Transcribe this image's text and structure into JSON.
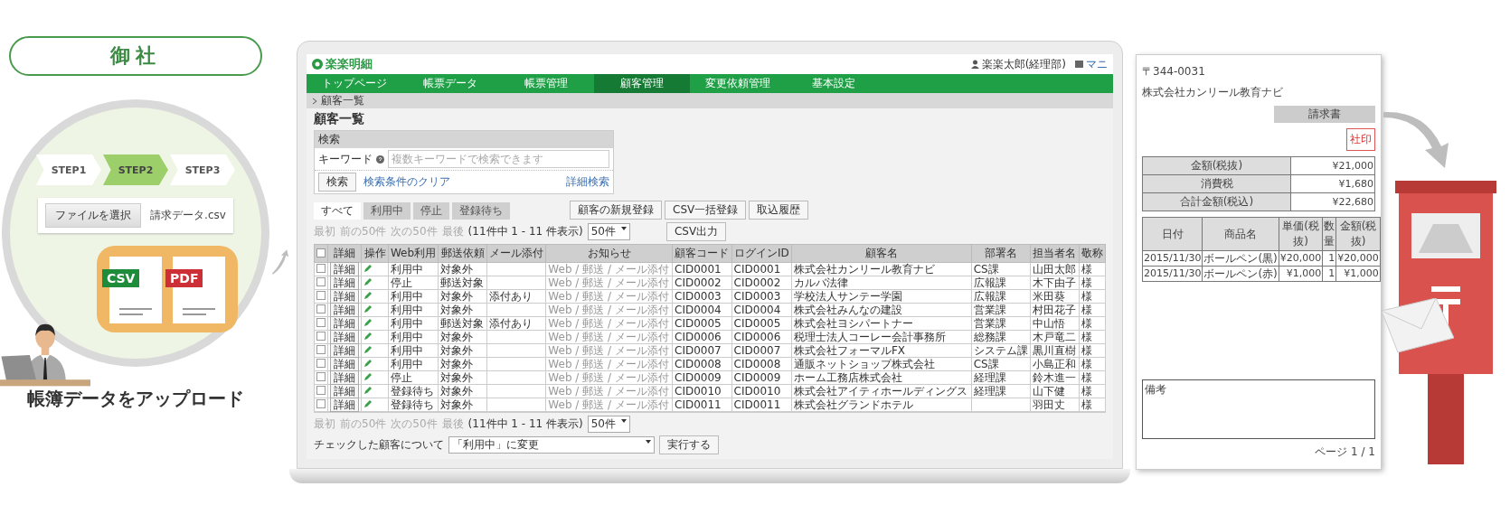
{
  "company": {
    "label": "御社",
    "steps": [
      {
        "label": "STEP1",
        "selected": false
      },
      {
        "label": "STEP2",
        "selected": true
      },
      {
        "label": "STEP3",
        "selected": false
      }
    ],
    "file_button": "ファイルを選択",
    "file_name": "請求データ.csv",
    "files": [
      {
        "type": "CSV",
        "color": "#1e8c3a"
      },
      {
        "type": "PDF",
        "color": "#cc2f36"
      }
    ],
    "caption": "帳簿データをアップロード"
  },
  "app": {
    "logo": "楽楽明細",
    "user": "楽楽太郎(経理部)",
    "manual": "マニ",
    "nav": [
      {
        "label": "トップページ",
        "selected": false
      },
      {
        "label": "帳票データ",
        "selected": false
      },
      {
        "label": "帳票管理",
        "selected": false
      },
      {
        "label": "顧客管理",
        "selected": true
      },
      {
        "label": "変更依頼管理",
        "selected": false
      },
      {
        "label": "基本設定",
        "selected": false
      }
    ],
    "breadcrumb": "顧客一覧",
    "title": "顧客一覧",
    "search": {
      "heading": "検索",
      "keyword_label": "キーワード",
      "placeholder": "複数キーワードで検索できます",
      "search_button": "検索",
      "clear_link": "検索条件のクリア",
      "advanced_link": "詳細検索"
    },
    "tabs": [
      {
        "label": "すべて",
        "selected": true
      },
      {
        "label": "利用中",
        "selected": false
      },
      {
        "label": "停止",
        "selected": false
      },
      {
        "label": "登録待ち",
        "selected": false
      }
    ],
    "actions": [
      "顧客の新規登録",
      "CSV一括登録",
      "取込履歴"
    ],
    "pager": {
      "links": [
        {
          "label": "最初",
          "disabled": true
        },
        {
          "label": "前の50件",
          "disabled": true
        },
        {
          "label": "次の50件",
          "disabled": true
        },
        {
          "label": "最後",
          "disabled": true
        }
      ],
      "summary": "(11件中 1 - 11 件表示)",
      "per_page": "50件"
    },
    "csv_button": "CSV出力",
    "table": {
      "select_all_checked": false,
      "columns": [
        "詳細",
        "操作",
        "Web利用",
        "郵送依頼",
        "メール添付",
        "お知らせ",
        "顧客コード",
        "ログインID",
        "顧客名",
        "部署名",
        "担当者名",
        "敬称"
      ],
      "rows": [
        {
          "checked": false,
          "detail": "詳細",
          "status": "利用中",
          "mail": "対象外",
          "notice": "Web / 郵送 / メール添付",
          "code": "CID0001",
          "login": "CID0001",
          "name": "株式会社カンリール教育ナビ",
          "dept": "CS課",
          "person": "山田太郎",
          "honorific": "様"
        },
        {
          "checked": false,
          "detail": "詳細",
          "status": "停止",
          "mail": "郵送対象",
          "notice": "Web / 郵送 / メール添付",
          "code": "CID0002",
          "login": "CID0002",
          "name": "カルバ法律",
          "dept": "広報課",
          "person": "木下由子",
          "honorific": "様"
        },
        {
          "checked": false,
          "detail": "詳細",
          "status": "利用中",
          "mail": "対象外",
          "attach": "添付あり",
          "notice": "Web / 郵送 / メール添付",
          "code": "CID0003",
          "login": "CID0003",
          "name": "学校法人サンテー学園",
          "dept": "広報課",
          "person": "米田葵",
          "honorific": "様"
        },
        {
          "checked": false,
          "detail": "詳細",
          "status": "利用中",
          "mail": "対象外",
          "notice": "Web / 郵送 / メール添付",
          "code": "CID0004",
          "login": "CID0004",
          "name": "株式会社みんなの建設",
          "dept": "営業課",
          "person": "村田花子",
          "honorific": "様"
        },
        {
          "checked": false,
          "detail": "詳細",
          "status": "利用中",
          "mail": "郵送対象",
          "attach": "添付あり",
          "notice": "Web / 郵送 / メール添付",
          "code": "CID0005",
          "login": "CID0005",
          "name": "株式会社ヨシパートナー",
          "dept": "営業課",
          "person": "中山悟",
          "honorific": "様"
        },
        {
          "checked": false,
          "detail": "詳細",
          "status": "利用中",
          "mail": "対象外",
          "notice": "Web / 郵送 / メール添付",
          "code": "CID0006",
          "login": "CID0006",
          "name": "税理士法人コーレー会計事務所",
          "dept": "総務課",
          "person": "木戸竜二",
          "honorific": "様"
        },
        {
          "checked": false,
          "detail": "詳細",
          "status": "利用中",
          "mail": "対象外",
          "notice": "Web / 郵送 / メール添付",
          "code": "CID0007",
          "login": "CID0007",
          "name": "株式会社フォーマルFX",
          "dept": "システム課",
          "person": "黒川直樹",
          "honorific": "様"
        },
        {
          "checked": false,
          "detail": "詳細",
          "status": "利用中",
          "mail": "対象外",
          "notice": "Web / 郵送 / メール添付",
          "code": "CID0008",
          "login": "CID0008",
          "name": "通販ネットショップ株式会社",
          "dept": "CS課",
          "person": "小島正和",
          "honorific": "様"
        },
        {
          "checked": false,
          "detail": "詳細",
          "status": "停止",
          "mail": "対象外",
          "notice": "Web / 郵送 / メール添付",
          "code": "CID0009",
          "login": "CID0009",
          "name": "ホーム工務店株式会社",
          "dept": "経理課",
          "person": "鈴木進一",
          "honorific": "様"
        },
        {
          "checked": false,
          "detail": "詳細",
          "status": "登録待ち",
          "mail": "対象外",
          "notice": "Web / 郵送 / メール添付",
          "code": "CID0010",
          "login": "CID0010",
          "name": "株式会社アイティホールディングス",
          "dept": "経理課",
          "person": "山下健",
          "honorific": "様"
        },
        {
          "checked": false,
          "detail": "詳細",
          "status": "登録待ち",
          "mail": "対象外",
          "notice": "Web / 郵送 / メール添付",
          "code": "CID0011",
          "login": "CID0011",
          "name": "株式会社グランドホテル",
          "person": "羽田丈",
          "honorific": "様"
        }
      ]
    },
    "pager_bottom": {
      "links": [
        {
          "label": "最初",
          "disabled": true
        },
        {
          "label": "前の50件",
          "disabled": true
        },
        {
          "label": "次の50件",
          "disabled": true
        },
        {
          "label": "最後",
          "disabled": true
        }
      ],
      "summary": "(11件中 1 - 11 件表示)",
      "per_page": "50件"
    },
    "bulk": {
      "label": "チェックした顧客について",
      "select": "「利用中」に変更",
      "button": "実行する"
    }
  },
  "invoice": {
    "postal": "〒344-0031",
    "recipient": "株式会社カンリール教育ナビ",
    "title": "請求書",
    "seal": "社印",
    "totals": [
      {
        "label": "金額(税抜)",
        "value": "¥21,000"
      },
      {
        "label": "消費税",
        "value": "¥1,680"
      },
      {
        "label": "合計金額(税込)",
        "value": "¥22,680"
      }
    ],
    "columns": [
      "日付",
      "商品名",
      "単価(税抜)",
      "数量",
      "金額(税抜)"
    ],
    "items": [
      [
        "2015/11/30",
        "ボールペン(黒)",
        "¥20,000",
        "1",
        "¥20,000"
      ],
      [
        "2015/11/30",
        "ボールペン(赤)",
        "¥1,000",
        "1",
        "¥1,000"
      ]
    ],
    "notes_label": "備考",
    "page": "ページ 1 / 1"
  }
}
